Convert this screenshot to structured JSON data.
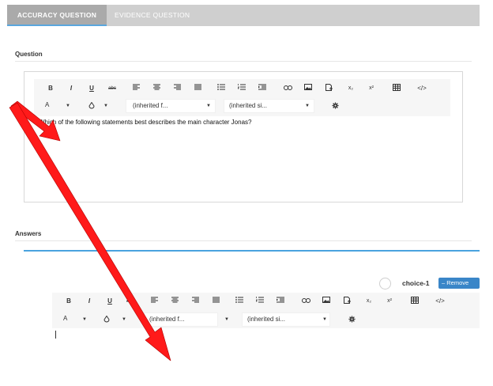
{
  "tabs": [
    {
      "label": "ACCURACY QUESTION",
      "active": true
    },
    {
      "label": "EVIDENCE QUESTION",
      "active": false
    }
  ],
  "question": {
    "section_title": "Question",
    "text": "Which of the following statements best describes the main character Jonas?"
  },
  "toolbar": {
    "bold": "B",
    "italic": "I",
    "underline": "U",
    "strike": "abc",
    "subscript": "x₂",
    "superscript": "x²",
    "code": "</>",
    "font_color": "A",
    "font_family": "(inherited f...",
    "font_size": "(inherited si..."
  },
  "answers": {
    "section_title": "Answers",
    "choice_label": "choice-1",
    "remove_label": "Remove",
    "remove_icon": "minus-icon"
  },
  "annotation": {
    "arrow_color": "#ff1a1a"
  },
  "colors": {
    "accent": "#4aa3df",
    "remove_button": "#3a86c8",
    "tab_active": "#aaaaaa",
    "tab_bar": "#cfcfcf"
  }
}
